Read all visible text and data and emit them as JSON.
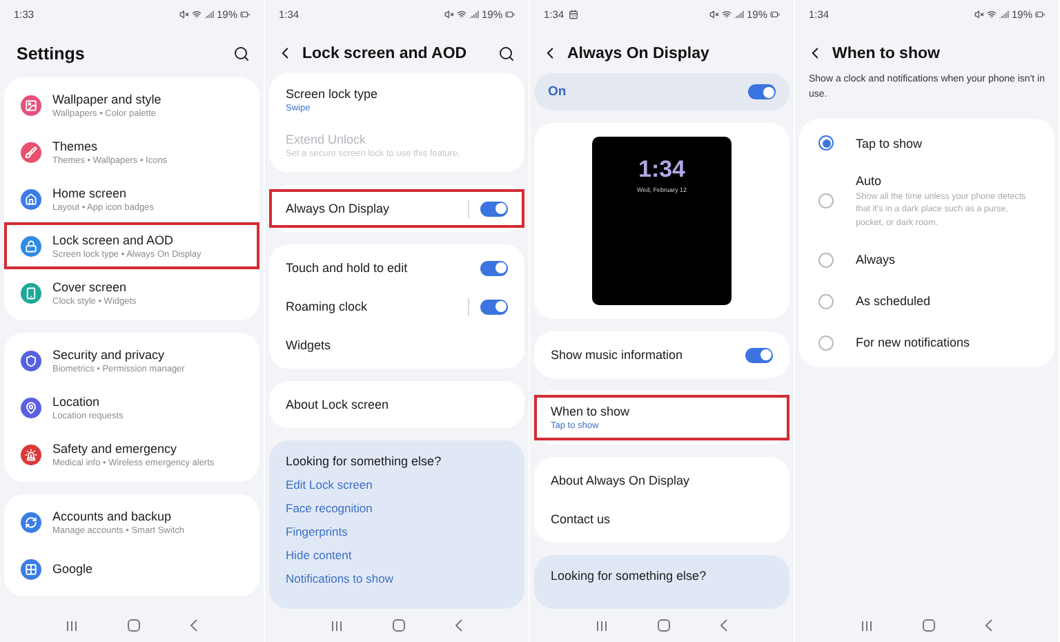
{
  "panels": [
    {
      "status": {
        "time": "1:33",
        "battery": "19%",
        "notification_icon": false
      },
      "header": {
        "title": "Settings",
        "back": false,
        "search": true,
        "large": true
      },
      "sections": [
        {
          "kind": "card",
          "rows": [
            {
              "kind": "menu",
              "title": "Wallpaper and style",
              "subtitle": "Wallpapers  •  Color palette",
              "color": "#e6507c",
              "highlighted": false
            },
            {
              "kind": "menu",
              "title": "Themes",
              "subtitle": "Themes  •  Wallpapers  •  Icons",
              "color": "#e8506e",
              "highlighted": false
            },
            {
              "kind": "menu",
              "title": "Home screen",
              "subtitle": "Layout  •  App icon badges",
              "color": "#3b7ce8",
              "highlighted": false
            },
            {
              "kind": "menu",
              "title": "Lock screen and AOD",
              "subtitle": "Screen lock type  •  Always On Display",
              "color": "#2f8ae6",
              "highlighted": true
            },
            {
              "kind": "menu",
              "title": "Cover screen",
              "subtitle": "Clock style  •  Widgets",
              "color": "#1fa898",
              "highlighted": false
            }
          ]
        },
        {
          "kind": "card",
          "rows": [
            {
              "kind": "menu",
              "title": "Security and privacy",
              "subtitle": "Biometrics  •  Permission manager",
              "color": "#5462e2",
              "highlighted": false
            },
            {
              "kind": "menu",
              "title": "Location",
              "subtitle": "Location requests",
              "color": "#5b5fe0",
              "highlighted": false
            },
            {
              "kind": "menu",
              "title": "Safety and emergency",
              "subtitle": "Medical info  •  Wireless emergency alerts",
              "color": "#d83a3a",
              "highlighted": false
            }
          ]
        },
        {
          "kind": "card",
          "rows": [
            {
              "kind": "menu",
              "title": "Accounts and backup",
              "subtitle": "Manage accounts  •  Smart Switch",
              "color": "#3a7de6",
              "highlighted": false
            },
            {
              "kind": "menu",
              "title": "Google",
              "color": "#3a7de6",
              "highlighted": false
            }
          ]
        }
      ]
    },
    {
      "status": {
        "time": "1:34",
        "battery": "19%",
        "notification_icon": false
      },
      "header": {
        "title": "Lock screen and AOD",
        "back": true,
        "search": true,
        "large": false
      },
      "sections": [
        {
          "kind": "card",
          "rows": [
            {
              "kind": "plain",
              "title": "Screen lock type",
              "subtitle": "Swipe",
              "disabled": false,
              "highlighted": false
            },
            {
              "kind": "plain",
              "title": "Extend Unlock",
              "subtitle": "Set a secure screen lock to use this feature.",
              "disabled": true,
              "highlighted": false
            }
          ]
        },
        {
          "kind": "card",
          "rows": [
            {
              "kind": "toggle",
              "title": "Always On Display",
              "on": true,
              "split": true,
              "highlighted": true
            }
          ]
        },
        {
          "kind": "card",
          "rows": [
            {
              "kind": "toggle",
              "title": "Touch and hold to edit",
              "on": true,
              "split": false,
              "highlighted": false
            },
            {
              "kind": "toggle",
              "title": "Roaming clock",
              "on": true,
              "split": true,
              "highlighted": false
            },
            {
              "kind": "plain",
              "title": "Widgets",
              "disabled": false,
              "highlighted": false
            }
          ]
        },
        {
          "kind": "card",
          "rows": [
            {
              "kind": "plain",
              "title": "About Lock screen",
              "disabled": false,
              "highlighted": false
            }
          ]
        },
        {
          "kind": "suggestions",
          "heading": "Looking for something else?",
          "links": [
            "Edit Lock screen",
            "Face recognition",
            "Fingerprints",
            "Hide content",
            "Notifications to show"
          ]
        }
      ]
    },
    {
      "status": {
        "time": "1:34",
        "battery": "19%",
        "notification_icon": true
      },
      "header": {
        "title": "Always On Display",
        "back": true,
        "search": false,
        "large": false
      },
      "sections": [
        {
          "kind": "master",
          "label": "On",
          "on": true
        },
        {
          "kind": "preview",
          "time": "1:34",
          "date": "Wed, February 12"
        },
        {
          "kind": "card",
          "rows": [
            {
              "kind": "toggle",
              "title": "Show music information",
              "on": true,
              "split": false,
              "highlighted": false
            }
          ]
        },
        {
          "kind": "card",
          "rows": [
            {
              "kind": "plain",
              "title": "When to show",
              "subtitle": "Tap to show",
              "disabled": false,
              "highlighted": true
            }
          ]
        },
        {
          "kind": "card",
          "rows": [
            {
              "kind": "plain",
              "title": "About Always On Display",
              "disabled": false,
              "highlighted": false
            },
            {
              "kind": "plain",
              "title": "Contact us",
              "disabled": false,
              "highlighted": false
            }
          ]
        },
        {
          "kind": "suggestions",
          "heading": "Looking for something else?"
        }
      ]
    },
    {
      "status": {
        "time": "1:34",
        "battery": "19%",
        "notification_icon": false
      },
      "header": {
        "title": "When to show",
        "back": true,
        "search": false,
        "large": false
      },
      "sections": [
        {
          "kind": "note",
          "text": "Show a clock and notifications when your phone isn't in use."
        },
        {
          "kind": "card",
          "rows": [
            {
              "kind": "radio",
              "title": "Tap to show",
              "selected": true
            },
            {
              "kind": "radio",
              "title": "Auto",
              "description": "Show all the time unless your phone detects that it's in a dark place such as a purse, pocket, or dark room.",
              "selected": false
            },
            {
              "kind": "radio",
              "title": "Always",
              "selected": false
            },
            {
              "kind": "radio",
              "title": "As scheduled",
              "selected": false
            },
            {
              "kind": "radio",
              "title": "For new notifications",
              "selected": false
            }
          ]
        }
      ]
    }
  ]
}
